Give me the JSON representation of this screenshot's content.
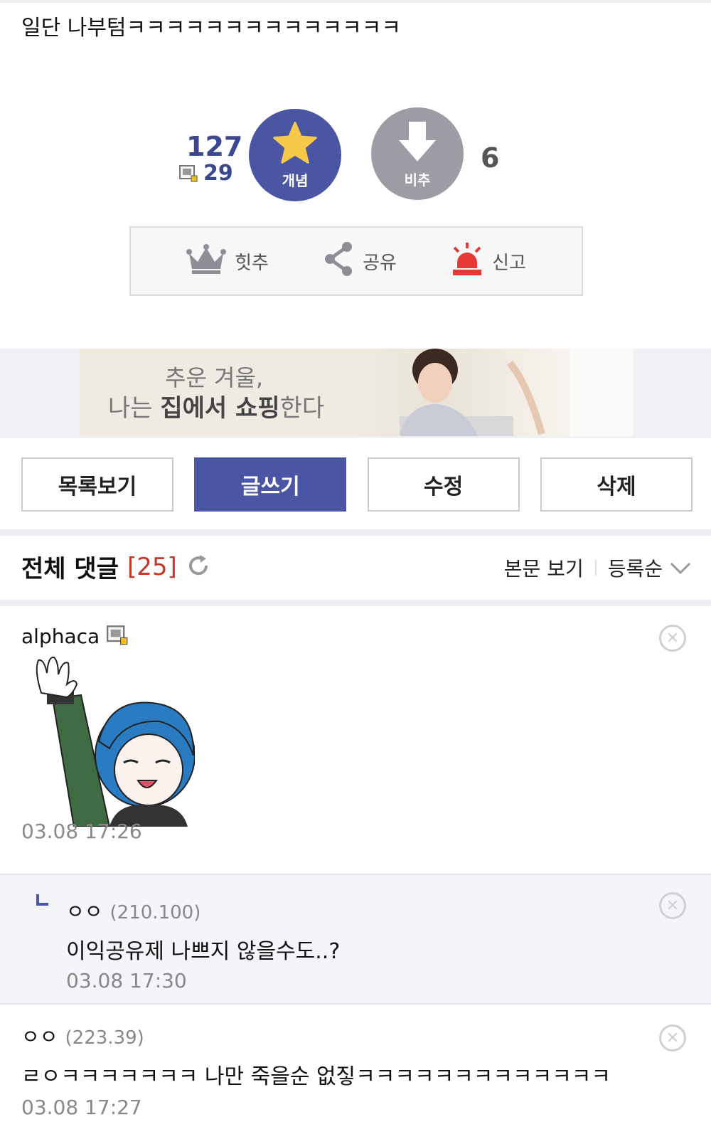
{
  "post": {
    "text": "일단 나부텀ㅋㅋㅋㅋㅋㅋㅋㅋㅋㅋㅋㅋㅋㅋ"
  },
  "recommend": {
    "up_count": "127",
    "fixed_up_count": "29",
    "up_label": "개념",
    "down_label": "비추",
    "down_count": "6"
  },
  "actions": {
    "hit": "힛추",
    "share": "공유",
    "report": "신고"
  },
  "ad": {
    "line1": "추운 겨울,",
    "line2_a": "나는 ",
    "line2_b": "집에서 쇼핑",
    "line2_c": "한다"
  },
  "buttons": {
    "list": "목록보기",
    "write": "글쓰기",
    "edit": "수정",
    "delete": "삭제"
  },
  "comments_header": {
    "title": "전체 댓글",
    "count": "[25]",
    "view_body": "본문 보기",
    "sort": "등록순"
  },
  "comments": [
    {
      "nick": "alphaca",
      "date": "03.08 17:26"
    },
    {
      "nick": "ㅇㅇ",
      "ip": "(210.100)",
      "text": "이익공유제 나쁘지 않을수도..?",
      "date": "03.08 17:30"
    },
    {
      "nick": "ㅇㅇ",
      "ip": "(223.39)",
      "text": "ㄹㅇㅋㅋㅋㅋㅋㅋㅋ 나만 죽을순 없짛ㅋㅋㅋㅋㅋㅋㅋㅋㅋㅋㅋㅋㅋ",
      "date": "03.08 17:27"
    }
  ],
  "colors": {
    "primary": "#4a55a3",
    "downvote": "#9b9ca4",
    "count_red": "#c0392b",
    "star": "#f7c948",
    "report_red": "#e53935"
  }
}
